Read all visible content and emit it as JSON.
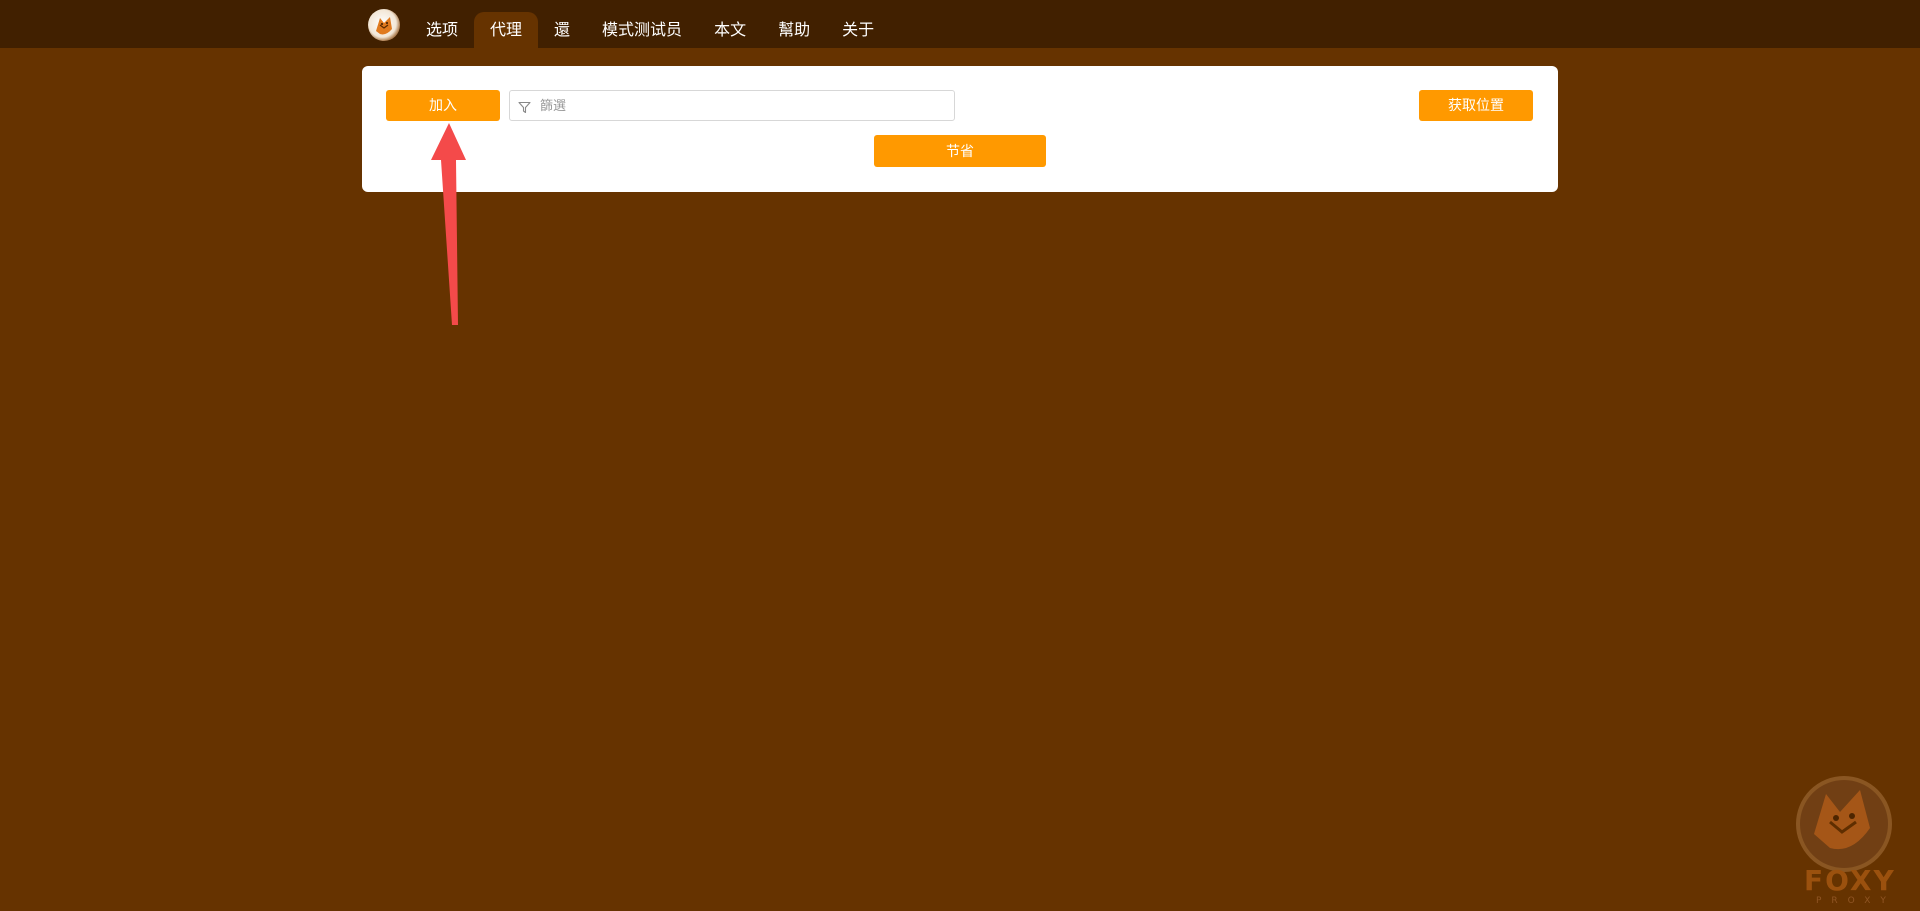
{
  "nav": {
    "tabs": [
      {
        "label": "选项"
      },
      {
        "label": "代理"
      },
      {
        "label": "還"
      },
      {
        "label": "模式测试员"
      },
      {
        "label": "本文"
      },
      {
        "label": "幫助"
      },
      {
        "label": "关于"
      }
    ],
    "active_tab": "代理"
  },
  "toolbar": {
    "add_label": "加入",
    "filter_placeholder": "篩選",
    "get_location_label": "获取位置",
    "save_label": "节省"
  },
  "watermark": {
    "word": "FOXY",
    "sub": "PROXY"
  },
  "colors": {
    "topbar": "#412000",
    "background": "#663300",
    "accent": "#ff9900",
    "annotation_arrow": "#f44a4a"
  },
  "icons": [
    "foxyproxy-logo-icon",
    "filter-icon",
    "annotation-arrow-icon",
    "foxyproxy-watermark-icon"
  ]
}
